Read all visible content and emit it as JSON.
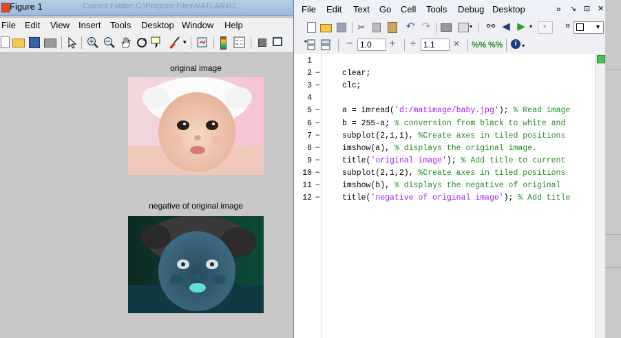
{
  "figure": {
    "title": "Figure 1",
    "background_title": "Current Folder: C:\\Program Files\\MATLAB\\R2...",
    "menu": [
      "File",
      "Edit",
      "View",
      "Insert",
      "Tools",
      "Desktop",
      "Window",
      "Help"
    ],
    "axes": [
      {
        "title": "original image"
      },
      {
        "title": "negative of original image"
      }
    ]
  },
  "editor": {
    "menu": [
      "File",
      "Edit",
      "Text",
      "Go",
      "Cell",
      "Tools",
      "Debug",
      "Desktop"
    ],
    "menu_right": [
      "»",
      "↘",
      "⊡",
      "✕"
    ],
    "cell_toolbar": {
      "minus": "−",
      "field1": "1.0",
      "plus": "+",
      "divide": "÷",
      "field2": "1.1",
      "times": "×"
    },
    "lines": [
      {
        "n": "1",
        "dash": "",
        "parts": []
      },
      {
        "n": "2",
        "dash": "−",
        "parts": [
          {
            "t": "clear;",
            "c": "k"
          }
        ]
      },
      {
        "n": "3",
        "dash": "−",
        "parts": [
          {
            "t": "clc;",
            "c": "k"
          }
        ]
      },
      {
        "n": "4",
        "dash": "",
        "parts": []
      },
      {
        "n": "5",
        "dash": "−",
        "parts": [
          {
            "t": "a = imread(",
            "c": "k"
          },
          {
            "t": "'d:/matimage/baby.jpg'",
            "c": "s"
          },
          {
            "t": "); ",
            "c": "k"
          },
          {
            "t": "% Read image",
            "c": "c"
          }
        ]
      },
      {
        "n": "6",
        "dash": "−",
        "parts": [
          {
            "t": "b = 255-a; ",
            "c": "k"
          },
          {
            "t": "% conversion from black to white and",
            "c": "c"
          }
        ]
      },
      {
        "n": "7",
        "dash": "−",
        "parts": [
          {
            "t": "subplot(2,1,1), ",
            "c": "k"
          },
          {
            "t": "%Create axes in tiled positions",
            "c": "c"
          }
        ]
      },
      {
        "n": "8",
        "dash": "−",
        "parts": [
          {
            "t": "imshow(a), ",
            "c": "k"
          },
          {
            "t": "% displays the original image.",
            "c": "c"
          }
        ]
      },
      {
        "n": "9",
        "dash": "−",
        "parts": [
          {
            "t": "title(",
            "c": "k"
          },
          {
            "t": "'original image'",
            "c": "s"
          },
          {
            "t": "); ",
            "c": "k"
          },
          {
            "t": "% Add title to current",
            "c": "c"
          }
        ]
      },
      {
        "n": "10",
        "dash": "−",
        "parts": [
          {
            "t": "subplot(2,1,2), ",
            "c": "k"
          },
          {
            "t": "%Create axes in tiled positions",
            "c": "c"
          }
        ]
      },
      {
        "n": "11",
        "dash": "−",
        "parts": [
          {
            "t": "imshow(b), ",
            "c": "k"
          },
          {
            "t": "% displays the negative of original",
            "c": "c"
          }
        ]
      },
      {
        "n": "12",
        "dash": "−",
        "parts": [
          {
            "t": "title(",
            "c": "k"
          },
          {
            "t": "'negative of original image'",
            "c": "s"
          },
          {
            "t": "); ",
            "c": "k"
          },
          {
            "t": "% Add title",
            "c": "c"
          }
        ]
      }
    ]
  },
  "colors": {
    "string": "#a020f0",
    "comment": "#228b22",
    "figure_bg": "#c8c8c8"
  }
}
